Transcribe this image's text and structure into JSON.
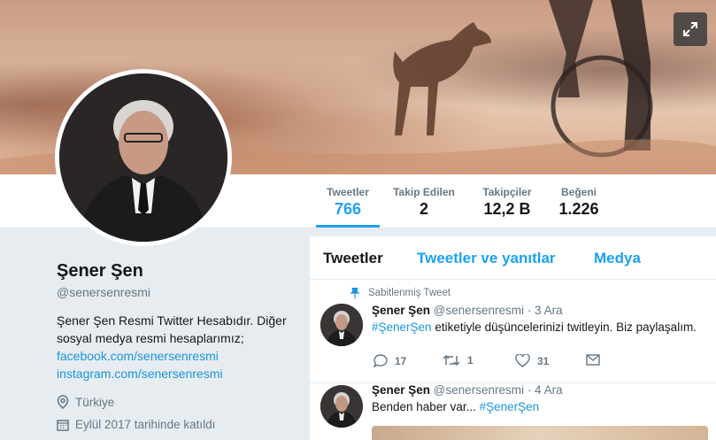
{
  "banner": {
    "expand_icon": "expand-arrows-icon"
  },
  "nav": {
    "stats": [
      {
        "label": "Tweetler",
        "value": "766",
        "active": true
      },
      {
        "label": "Takip Edilen",
        "value": "2"
      },
      {
        "label": "Takipçiler",
        "value": "12,2 B"
      },
      {
        "label": "Beğeni",
        "value": "1.226"
      }
    ]
  },
  "profile": {
    "name": "Şener Şen",
    "handle": "@senersenresmi",
    "bio_line1": "Şener Şen Resmi Twitter Hesabıdır. Diğer",
    "bio_line2": "sosyal medya resmi hesaplarımız;",
    "link1": "facebook.com/senersenresmi",
    "link2": "instagram.com/senersenresmi",
    "location": "Türkiye",
    "joined": "Eylül 2017 tarihinde katıldı"
  },
  "timeline": {
    "tabs": [
      "Tweetler",
      "Tweetler ve yanıtlar",
      "Medya"
    ],
    "tweets": [
      {
        "pinned_label": "Sabitlenmiş Tweet",
        "name": "Şener Şen",
        "handle": "@senersenresmi",
        "date": "· 3 Ara",
        "hashtag": "#ŞenerŞen",
        "text": " etiketiyle düşüncelerinizi twitleyin. Biz paylaşalım.",
        "replies": "17",
        "retweets": "1",
        "likes": "31"
      },
      {
        "name": "Şener Şen",
        "handle": "@senersenresmi",
        "date": "· 4 Ara",
        "text": "Benden haber var... ",
        "hashtag": "#ŞenerŞen"
      }
    ]
  },
  "colors": {
    "accent": "#1da1f2",
    "link": "#1b95e0",
    "muted": "#657786"
  }
}
